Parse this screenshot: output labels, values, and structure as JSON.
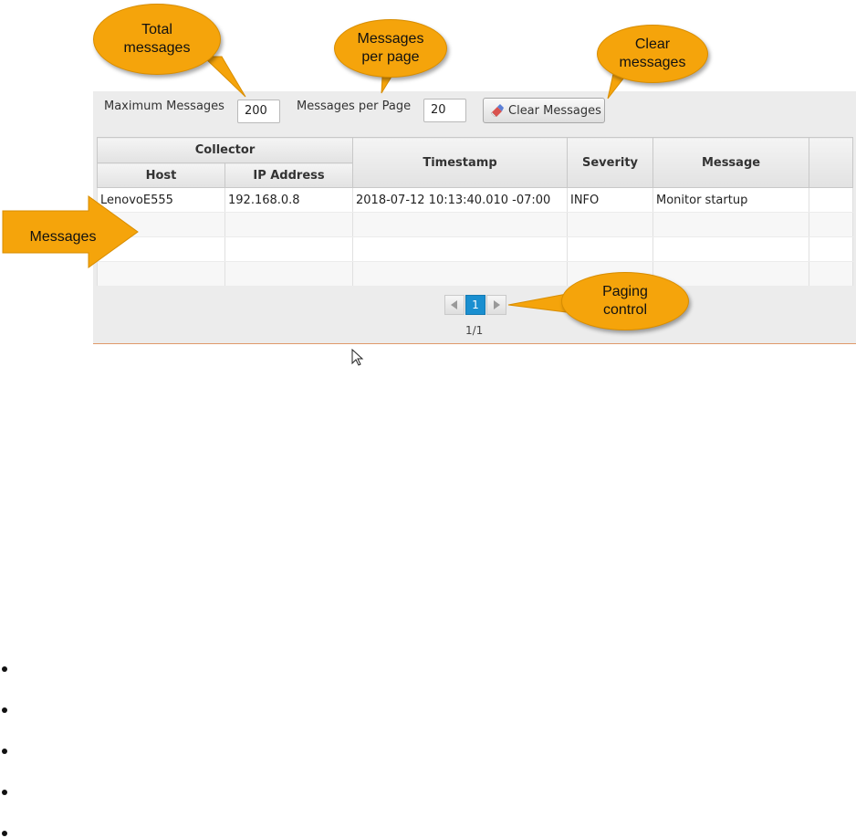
{
  "controls": {
    "max_messages_label": "Maximum Messages",
    "max_messages_value": "200",
    "per_page_label": "Messages per Page",
    "per_page_value": "20",
    "clear_button_label": "Clear Messages"
  },
  "table": {
    "group_header": "Collector",
    "columns": [
      "Host",
      "IP Address",
      "Timestamp",
      "Severity",
      "Message"
    ],
    "rows": [
      [
        "LenovoE555",
        "192.168.0.8",
        "2018-07-12 10:13:40.010 -07:00",
        "INFO",
        "Monitor startup"
      ],
      [
        "",
        "",
        "",
        "",
        ""
      ],
      [
        "",
        "",
        "",
        "",
        ""
      ],
      [
        "",
        "",
        "",
        "",
        ""
      ]
    ]
  },
  "pager": {
    "current_page": "1",
    "page_info": "1/1"
  },
  "callouts": {
    "total_messages": "Total\nmessages",
    "messages_per_page": "Messages\nper page",
    "clear_messages": "Clear\nmessages",
    "messages": "Messages",
    "paging_control": "Paging\ncontrol"
  },
  "colors": {
    "callout": "#f5a40b",
    "pager_active": "#1a8fd0",
    "panel_border": "#e09a6a"
  }
}
